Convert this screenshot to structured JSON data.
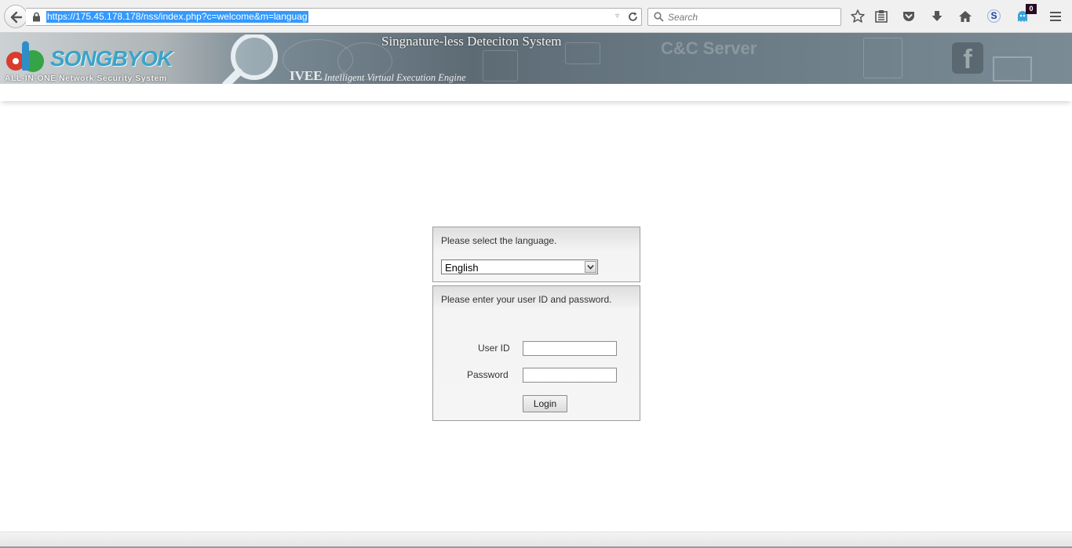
{
  "browser": {
    "url": "https://175.45.178.178/nss/index.php?c=welcome&m=languag",
    "search_placeholder": "Search",
    "s_badge": "S",
    "notification_count": "0"
  },
  "banner": {
    "logo_text": "SONGBYOK",
    "logo_subtitle": "ALL-IN-ONE Network Security System",
    "title": "Singnature-less Deteciton System",
    "engine_abbr": "IVEE",
    "engine_name": "Intelligent Virtual Execution Engine",
    "bg_text": "C&C Server"
  },
  "language_panel": {
    "message": "Please select the language.",
    "selected_language": "English"
  },
  "login_panel": {
    "message": "Please enter your user ID and password.",
    "user_id_label": "User ID",
    "password_label": "Password",
    "login_button": "Login"
  }
}
